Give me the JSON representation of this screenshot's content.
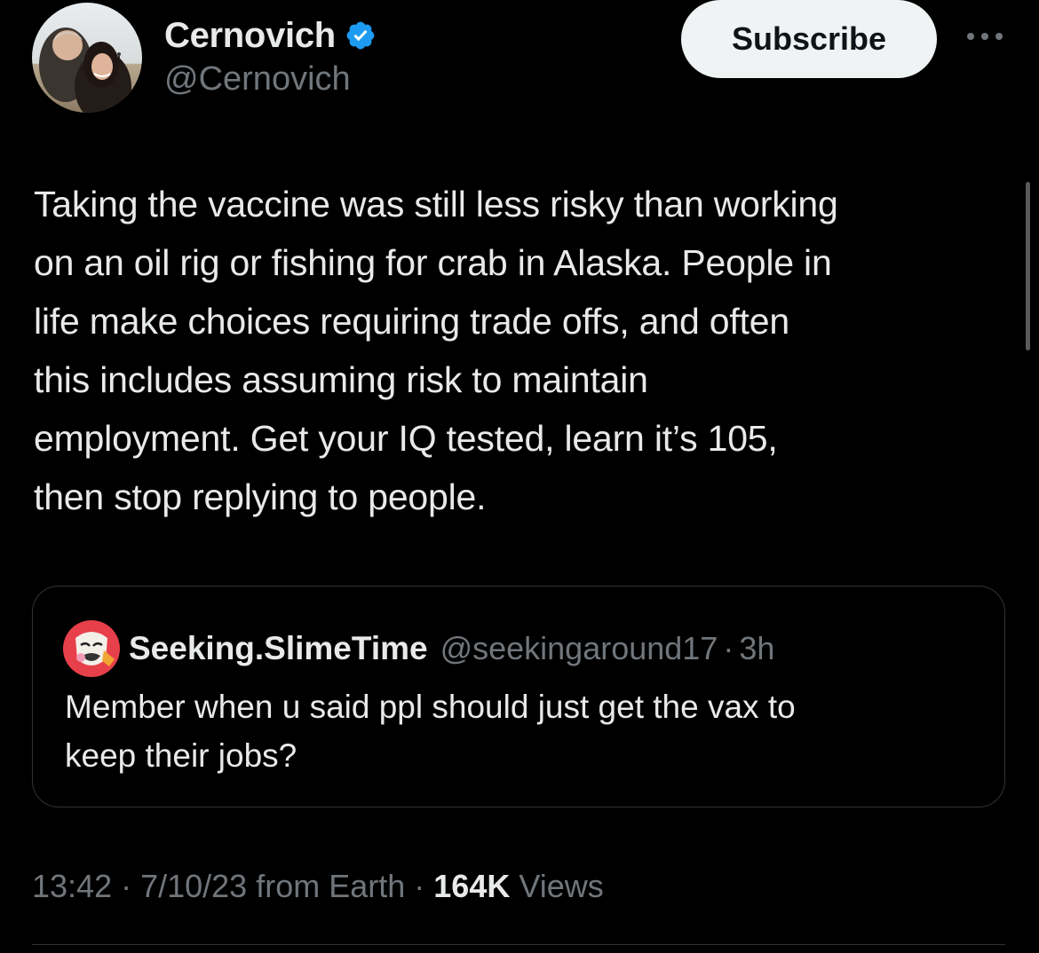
{
  "author": {
    "display_name": "Cernovich",
    "handle": "@Cernovich",
    "verified_icon": "verified-badge-icon",
    "verified_color": "#1d9bf0"
  },
  "actions": {
    "subscribe_label": "Subscribe",
    "more_icon": "more-horizontal-icon"
  },
  "tweet": {
    "text": "Taking the vaccine was still less risky than working\non an oil rig or fishing for crab in Alaska. People in\nlife make choices requiring trade offs, and often\nthis includes assuming risk to maintain\nemployment. Get your IQ tested, learn it’s 105,\nthen stop replying to people."
  },
  "quote": {
    "display_name": "Seeking.SlimeTime",
    "handle": "@seekingaround17",
    "separator": "·",
    "time": "3h",
    "text": "Member when u said ppl should just get the vax to\nkeep their jobs?"
  },
  "meta": {
    "time": "13:42",
    "separator1": " · ",
    "date": "7/10/23",
    "source": " from Earth",
    "separator2": " · ",
    "views_count": "164K",
    "views_label": " Views"
  },
  "colors": {
    "background": "#000000",
    "text_primary": "#e7e9ea",
    "text_secondary": "#71767b",
    "border": "#2f3336",
    "button_bg": "#eff3f4"
  }
}
